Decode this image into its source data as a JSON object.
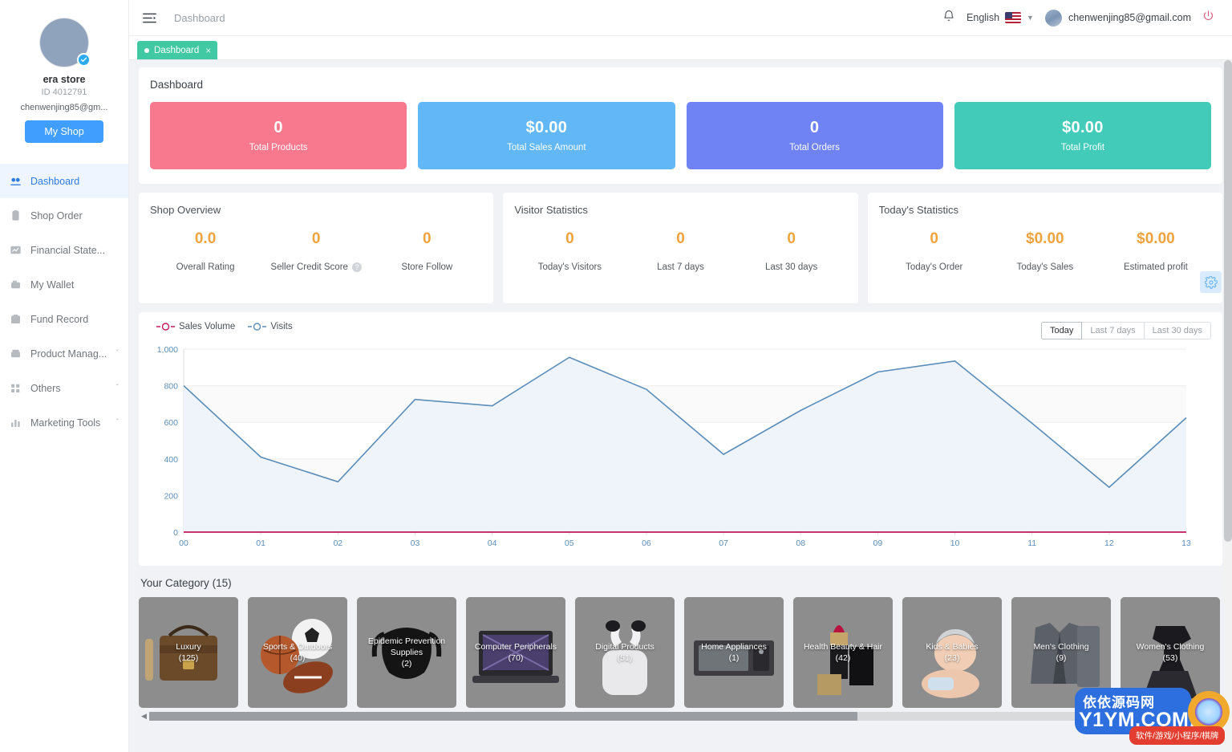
{
  "sidebar": {
    "store_name": "era store",
    "store_id": "ID 4012791",
    "store_email": "chenwenjing85@gm...",
    "my_shop_label": "My Shop",
    "items": [
      {
        "label": "Dashboard",
        "icon": "dashboard-icon",
        "active": true,
        "caret": ""
      },
      {
        "label": "Shop Order",
        "icon": "clipboard-icon",
        "active": false,
        "caret": ""
      },
      {
        "label": "Financial State...",
        "icon": "chart-icon",
        "active": false,
        "caret": ""
      },
      {
        "label": "My Wallet",
        "icon": "wallet-icon",
        "active": false,
        "caret": ""
      },
      {
        "label": "Fund Record",
        "icon": "folder-icon",
        "active": false,
        "caret": ""
      },
      {
        "label": "Product Manag...",
        "icon": "box-icon",
        "active": false,
        "caret": "ˇ"
      },
      {
        "label": "Others",
        "icon": "grid-icon",
        "active": false,
        "caret": "ˇ"
      },
      {
        "label": "Marketing Tools",
        "icon": "bars-icon",
        "active": false,
        "caret": "ˇ"
      }
    ]
  },
  "topbar": {
    "breadcrumb": "Dashboard",
    "language": "English",
    "user_email": "chenwenjing85@gmail.com",
    "tab_label": "Dashboard",
    "tab_close": "×"
  },
  "dashboard": {
    "title": "Dashboard",
    "stats": [
      {
        "value": "0",
        "label": "Total Products",
        "color": "#f8798e"
      },
      {
        "value": "$0.00",
        "label": "Total Sales Amount",
        "color": "#62b8f7"
      },
      {
        "value": "0",
        "label": "Total Orders",
        "color": "#6f83f4"
      },
      {
        "value": "$0.00",
        "label": "Total Profit",
        "color": "#43cbb9"
      }
    ]
  },
  "panels": [
    {
      "title": "Shop Overview",
      "metrics": [
        {
          "value": "0.0",
          "label": "Overall Rating",
          "help": false
        },
        {
          "value": "0",
          "label": "Seller Credit Score",
          "help": true
        },
        {
          "value": "0",
          "label": "Store Follow",
          "help": false
        }
      ]
    },
    {
      "title": "Visitor Statistics",
      "metrics": [
        {
          "value": "0",
          "label": "Today's Visitors",
          "help": false
        },
        {
          "value": "0",
          "label": "Last 7 days",
          "help": false
        },
        {
          "value": "0",
          "label": "Last 30 days",
          "help": false
        }
      ]
    },
    {
      "title": "Today's Statistics",
      "metrics": [
        {
          "value": "0",
          "label": "Today's Order",
          "help": false
        },
        {
          "value": "$0.00",
          "label": "Today's Sales",
          "help": false
        },
        {
          "value": "$0.00",
          "label": "Estimated profit",
          "help": false
        }
      ]
    }
  ],
  "chart_controls": {
    "ranges": [
      {
        "label": "Today",
        "selected": true
      },
      {
        "label": "Last 7 days",
        "selected": false
      },
      {
        "label": "Last 30 days",
        "selected": false
      }
    ]
  },
  "chart_data": {
    "type": "line",
    "title": "",
    "xlabel": "",
    "ylabel": "",
    "grid": true,
    "legend_position": "top-left",
    "ylim": [
      0,
      1000
    ],
    "yticks": [
      0,
      200,
      400,
      600,
      800,
      1000
    ],
    "ytick_labels": [
      "0",
      "200",
      "400",
      "600",
      "800",
      "1,000"
    ],
    "x": [
      "00",
      "01",
      "02",
      "03",
      "04",
      "05",
      "06",
      "07",
      "08",
      "09",
      "10",
      "11",
      "12",
      "13"
    ],
    "series": [
      {
        "name": "Sales Volume",
        "color": "#c2185b",
        "values": [
          0,
          0,
          0,
          0,
          0,
          0,
          0,
          0,
          0,
          0,
          0,
          0,
          0,
          0
        ]
      },
      {
        "name": "Visits",
        "color": "#5b8db8",
        "values": [
          800,
          410,
          275,
          725,
          690,
          955,
          780,
          425,
          665,
          875,
          935,
          595,
          245,
          625
        ]
      }
    ]
  },
  "category": {
    "title": "Your Category",
    "count": "(15)",
    "items": [
      {
        "name": "Luxury",
        "count": "(125)",
        "art": "bag"
      },
      {
        "name": "Sports & Outdoors",
        "count": "(40)",
        "art": "sports"
      },
      {
        "name": "Epidemic Prevention Supplies",
        "count": "(2)",
        "art": "mask"
      },
      {
        "name": "Computer Peripherals",
        "count": "(70)",
        "art": "laptop"
      },
      {
        "name": "Digital Products",
        "count": "(51)",
        "art": "earbuds"
      },
      {
        "name": "Home Appliances",
        "count": "(1)",
        "art": "microwave"
      },
      {
        "name": "Health Beauty & Hair",
        "count": "(42)",
        "art": "lipstick"
      },
      {
        "name": "Kids & Babies",
        "count": "(23)",
        "art": "baby"
      },
      {
        "name": "Men's Clothing",
        "count": "(9)",
        "art": "suit"
      },
      {
        "name": "Women's Clothing",
        "count": "(53)",
        "art": "dress"
      }
    ]
  },
  "watermark": {
    "cn_title": "依依源码网",
    "domain": "Y1YM.COM",
    "tagline": "软件/游戏/小程序/棋牌"
  }
}
